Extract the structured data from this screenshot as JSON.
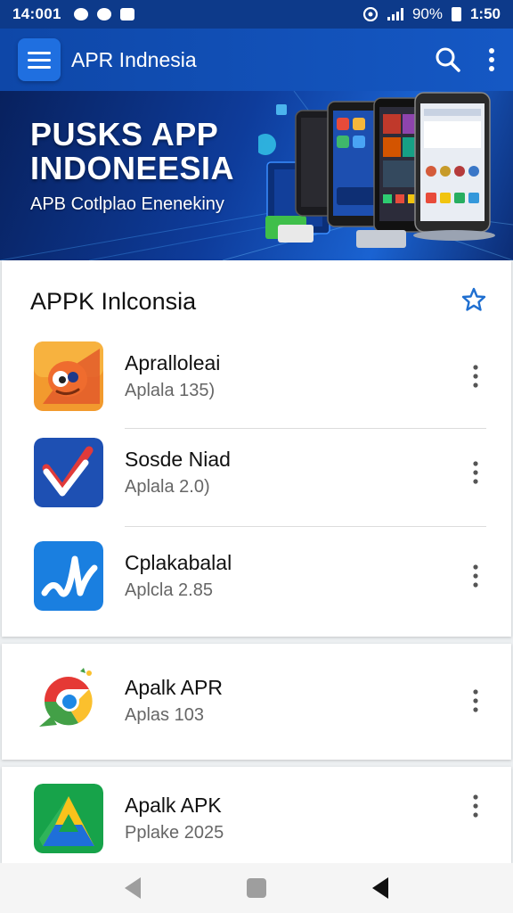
{
  "status_bar": {
    "time": "14:001",
    "battery": "90%",
    "clock": "1:50"
  },
  "app_bar": {
    "title": "APR Indnesia"
  },
  "banner": {
    "title_line1": "PUSKS APP",
    "title_line2": "INDONEESIA",
    "subtitle": "APB Cotlplao Enenekiny"
  },
  "section": {
    "title": "APPK Inlconsia"
  },
  "apps": [
    {
      "name": "Apralloleai",
      "subtitle": "Aplala 135)",
      "icon": "orange-face-icon"
    },
    {
      "name": "Sosde Niad",
      "subtitle": "Aplala 2.0)",
      "icon": "blue-check-icon"
    },
    {
      "name": "Cplakabalal",
      "subtitle": "Aplcla 2.85",
      "icon": "blue-wave-icon"
    },
    {
      "name": "Apalk APR",
      "subtitle": "Aplas 103",
      "icon": "chrome-like-icon"
    },
    {
      "name": "Apalk APK",
      "subtitle": "Pplake 2025",
      "icon": "drive-like-icon"
    }
  ],
  "colors": {
    "app_bar": "#0e47a8",
    "accent": "#1558c4"
  }
}
